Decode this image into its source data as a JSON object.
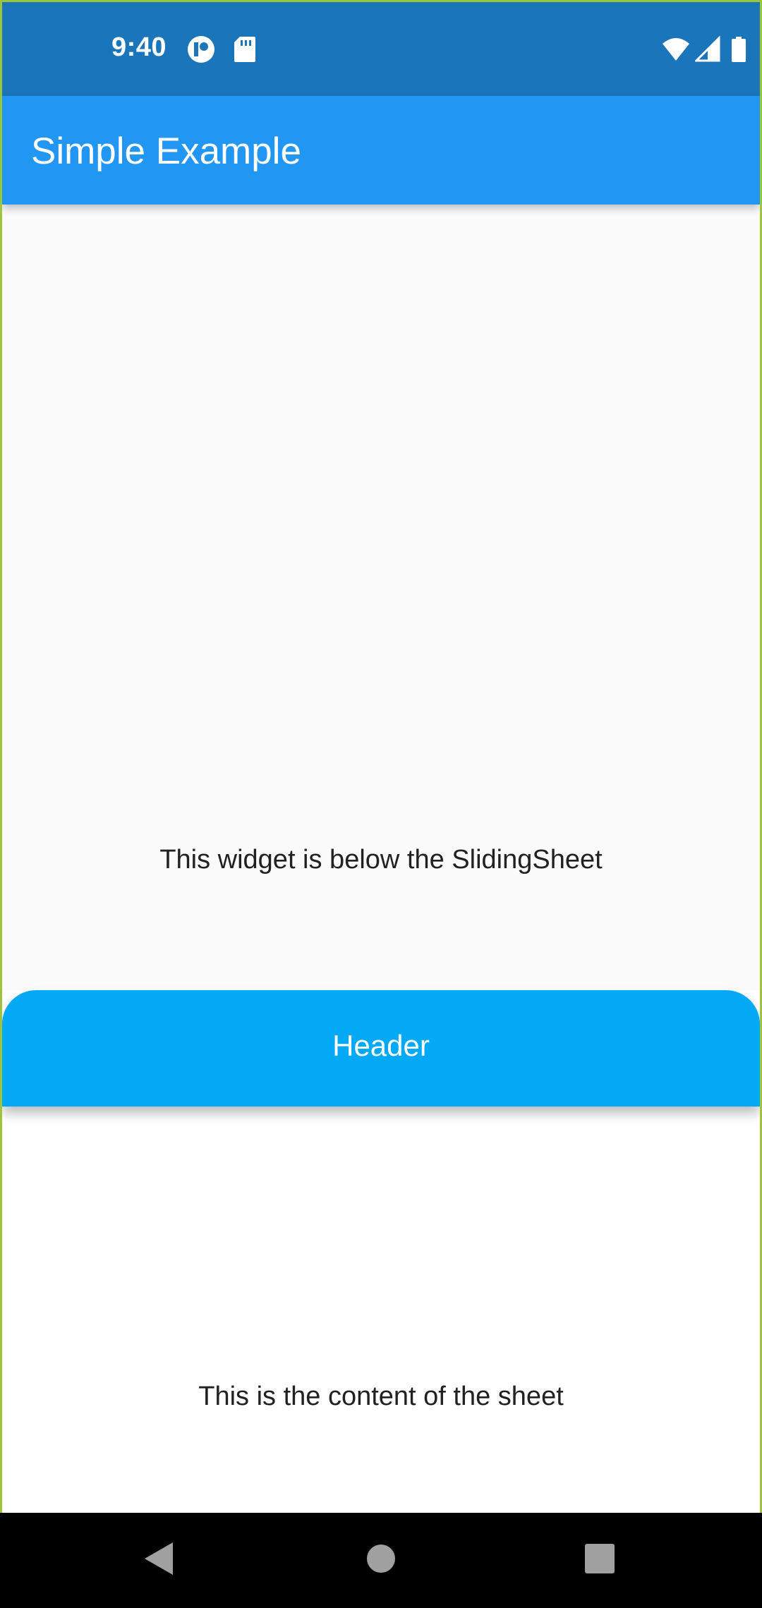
{
  "status_bar": {
    "time": "9:40",
    "left_icons": [
      "notification-app-icon",
      "sd-card-icon"
    ],
    "right_icons": [
      "wifi-icon",
      "cellular-signal-icon",
      "battery-icon"
    ],
    "background_color": "#1b75bb"
  },
  "app_bar": {
    "title": "Simple Example",
    "background_color": "#2196f3"
  },
  "body": {
    "below_sheet_text": "This widget is below the SlidingSheet"
  },
  "sheet": {
    "header_label": "Header",
    "header_color": "#03a9f4",
    "content_text": "This is the content of the sheet"
  },
  "nav_bar": {
    "buttons": [
      "back-icon",
      "home-icon",
      "recents-icon"
    ]
  }
}
